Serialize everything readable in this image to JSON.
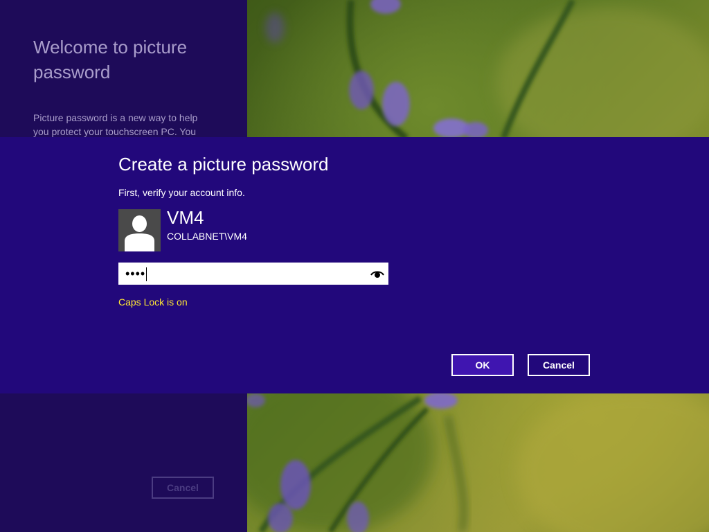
{
  "background": {
    "left_title": "Welcome to picture password",
    "left_description": "Picture password is a new way to help you protect your touchscreen PC. You",
    "cancel_label": "Cancel"
  },
  "dialog": {
    "title": "Create a picture password",
    "subtitle": "First, verify your account info.",
    "account": {
      "name": "VM4",
      "domain": "COLLABNET\\VM4",
      "avatar_icon": "user-avatar-icon"
    },
    "password": {
      "masked_value": "••••",
      "reveal_icon": "eye-icon"
    },
    "caps_lock_warning": "Caps Lock is on",
    "ok_label": "OK",
    "cancel_label": "Cancel"
  },
  "colors": {
    "dialog_bg": "#22087b",
    "left_panel_bg": "#1e0b59",
    "ok_button_bg": "#3f15b0",
    "warning_text": "#ffe833"
  }
}
